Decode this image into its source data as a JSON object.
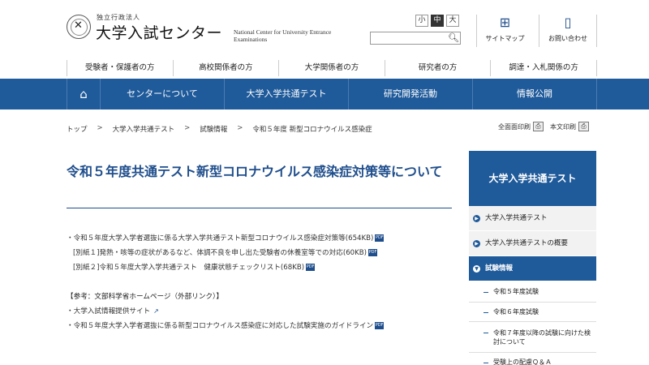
{
  "header": {
    "logo_sub": "独立行政法人",
    "logo_main": "大学入試センター",
    "logo_en": "National Center for University Entrance Examinations",
    "font_size": {
      "small": "小",
      "medium": "中",
      "large": "大"
    },
    "search": {
      "placeholder": ""
    },
    "sitemap_label": "サイトマップ",
    "contact_label": "お問い合わせ"
  },
  "audience_nav": [
    "受験者・保護者の方",
    "高校関係者の方",
    "大学関係者の方",
    "研究者の方",
    "調達・入札関係の方"
  ],
  "main_nav": [
    "センターについて",
    "大学入学共通テスト",
    "研究開発活動",
    "情報公開"
  ],
  "breadcrumb": [
    "トップ",
    "大学入学共通テスト",
    "試験情報",
    "令和５年度 新型コロナウイルス感染症"
  ],
  "breadcrumb_sep": ">",
  "print": {
    "full": "全面面印刷",
    "body": "本文印刷"
  },
  "title": "令和５年度共通テスト新型コロナウイルス感染症対策等について",
  "content": {
    "items": [
      "・令和５年度大学入学者選抜に係る大学入学共通テスト新型コロナウイルス感染症対策等(654KB)",
      "[別紙１]発熱・咳等の症状があるなど、体調不良を申し出た受験者の休養室等での対応(60KB)",
      "[別紙２]令和５年度大学入学共通テスト　健康状態チェックリスト(68KB)"
    ],
    "ref_heading": "【参考：文部科学省ホームページ（外部リンク）】",
    "ref_items": [
      "・大学入試情報提供サイト",
      "・令和５年度大学入学者選抜に係る新型コロナウイルス感染症に対応した試験実施のガイドライン"
    ],
    "pdf_label": "PDF"
  },
  "sidebar": {
    "heading": "大学入学共通テスト",
    "items": [
      "大学入学共通テスト",
      "大学入学共通テストの概要",
      "試験情報"
    ],
    "subitems": [
      "令和５年度試験",
      "令和６年度試験",
      "令和７年度以降の試験に向けた検討について",
      "受験上の配慮Ｑ＆Ａ"
    ]
  },
  "colors": {
    "primary": "#1f5a9a",
    "title": "#1f4e8c"
  },
  "icons": {
    "home": "home-icon",
    "search": "search-icon",
    "sitemap": "sitemap-icon",
    "contact": "phone-icon",
    "print": "printer-icon",
    "pdf": "pdf-icon",
    "external": "external-link-icon"
  }
}
